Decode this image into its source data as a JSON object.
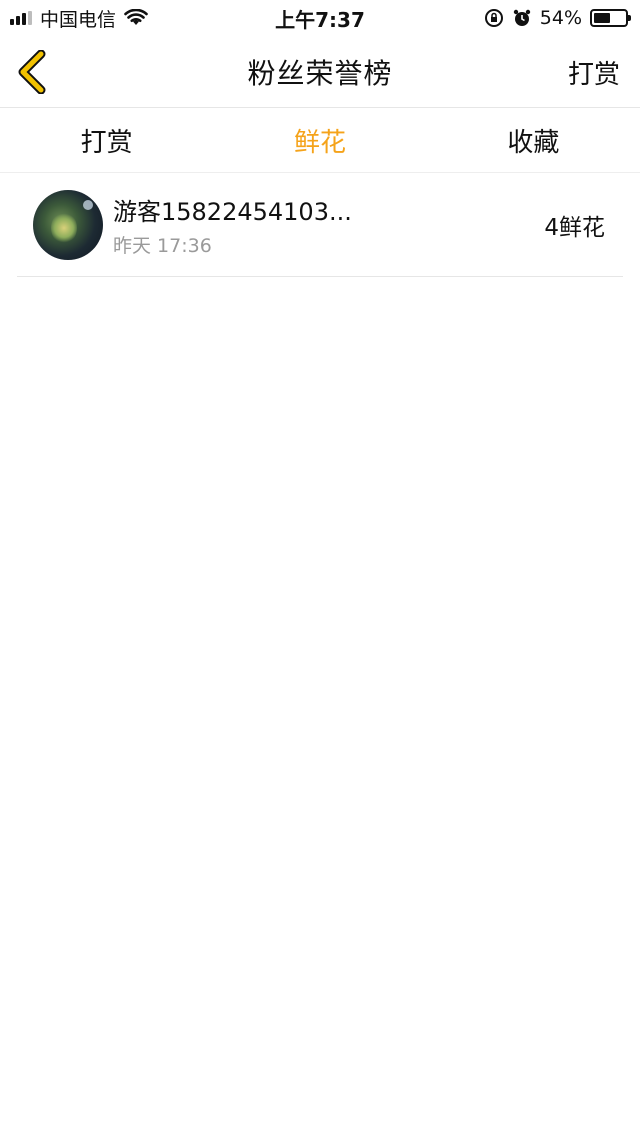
{
  "status_bar": {
    "carrier": "中国电信",
    "time": "上午7:37",
    "battery_percent": "54%",
    "battery_level": 0.54
  },
  "nav": {
    "title": "粉丝荣誉榜",
    "right_action": "打赏"
  },
  "tabs": [
    {
      "label": "打赏",
      "active": false
    },
    {
      "label": "鲜花",
      "active": true
    },
    {
      "label": "收藏",
      "active": false
    }
  ],
  "list": [
    {
      "name": "游客15822454103...",
      "time": "昨天 17:36",
      "count": "4鲜花"
    }
  ],
  "colors": {
    "accent": "#f5a31a",
    "back_icon": "#f2c200",
    "divider": "#e6e6e6"
  },
  "icons": [
    "signal-icon",
    "wifi-icon",
    "orientation-lock-icon",
    "alarm-icon",
    "battery-icon",
    "back-chevron-icon"
  ]
}
